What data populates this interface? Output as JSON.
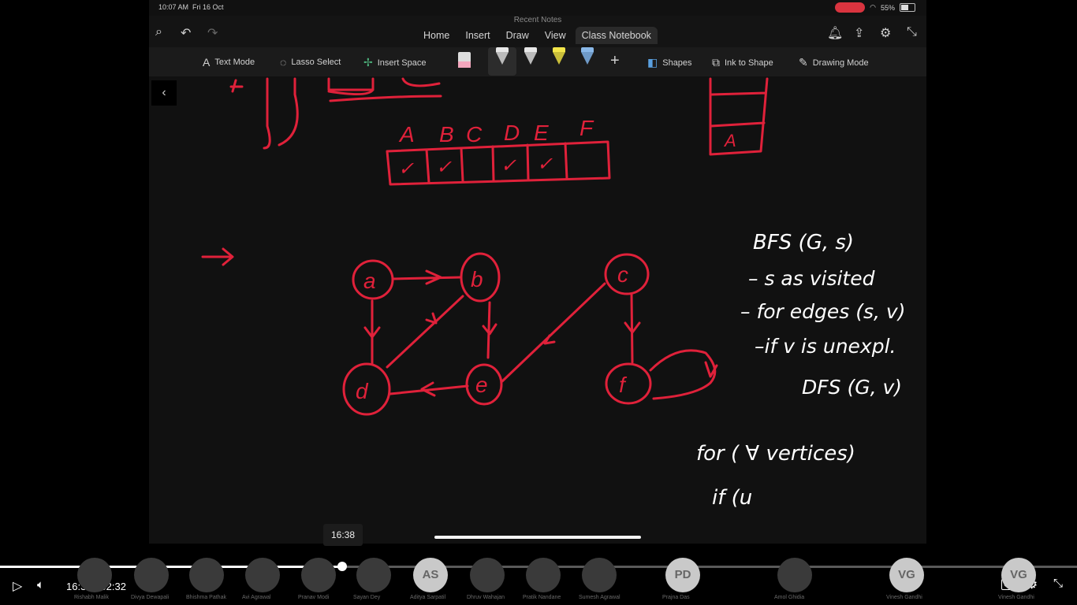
{
  "status": {
    "time": "10:07 AM",
    "date": "Fri 16 Oct",
    "battery": "55%"
  },
  "app": {
    "note_title": "Recent Notes",
    "tabs": [
      {
        "label": "Home"
      },
      {
        "label": "Insert"
      },
      {
        "label": "Draw"
      },
      {
        "label": "View"
      },
      {
        "label": "Class Notebook"
      }
    ],
    "active_tab": "Class Notebook"
  },
  "draw_tools": {
    "text_mode": "Text Mode",
    "lasso_select": "Lasso Select",
    "insert_space": "Insert Space",
    "shapes": "Shapes",
    "ink_to_shape": "Ink to Shape",
    "drawing_mode": "Drawing Mode",
    "pen_colors": [
      "#e8e8e8",
      "#f2f2f2",
      "#f3e64a",
      "#8ab8e8"
    ],
    "ink_color": "#e0213a"
  },
  "canvas": {
    "array_letters": [
      "A",
      "B",
      "C",
      "D",
      "E",
      "F"
    ],
    "array_marks": [
      "✓",
      "✓",
      "",
      "✓",
      "✓",
      ""
    ],
    "stack_item": "A",
    "nodes": [
      "a",
      "b",
      "c",
      "d",
      "e",
      "f"
    ],
    "notes": [
      "BFS (G, s)",
      "– s as visited",
      "– for edges (s, v)",
      "–if v is unexpl.",
      "DFS (G, v)",
      "for ( ∀ vertices)",
      "if (u"
    ]
  },
  "video": {
    "tooltip_time": "16:38",
    "current_time": "16:38",
    "separator": "/",
    "duration": "52:32",
    "progress": 0.318
  },
  "participants": [
    {
      "name": "Rishabh Malik",
      "initials": ""
    },
    {
      "name": "Divya Dewapali",
      "initials": ""
    },
    {
      "name": "Bhishma Pathak",
      "initials": ""
    },
    {
      "name": "Avi Agrawal",
      "initials": ""
    },
    {
      "name": "Pranav Modi",
      "initials": ""
    },
    {
      "name": "Sayan Dey",
      "initials": ""
    },
    {
      "name": "Aditya Sarpatil",
      "initials": "AS"
    },
    {
      "name": "Dhruv Wahajan",
      "initials": ""
    },
    {
      "name": "Pratik Nandane",
      "initials": ""
    },
    {
      "name": "Sumesh Agrawal",
      "initials": ""
    },
    {
      "name": "Prajna Das",
      "initials": "PD"
    },
    {
      "name": "Amol Ghidia",
      "initials": ""
    },
    {
      "name": "Vinesh Gandhi",
      "initials": "VG"
    },
    {
      "name": "Vinesh Gandhi",
      "initials": "VG"
    }
  ]
}
